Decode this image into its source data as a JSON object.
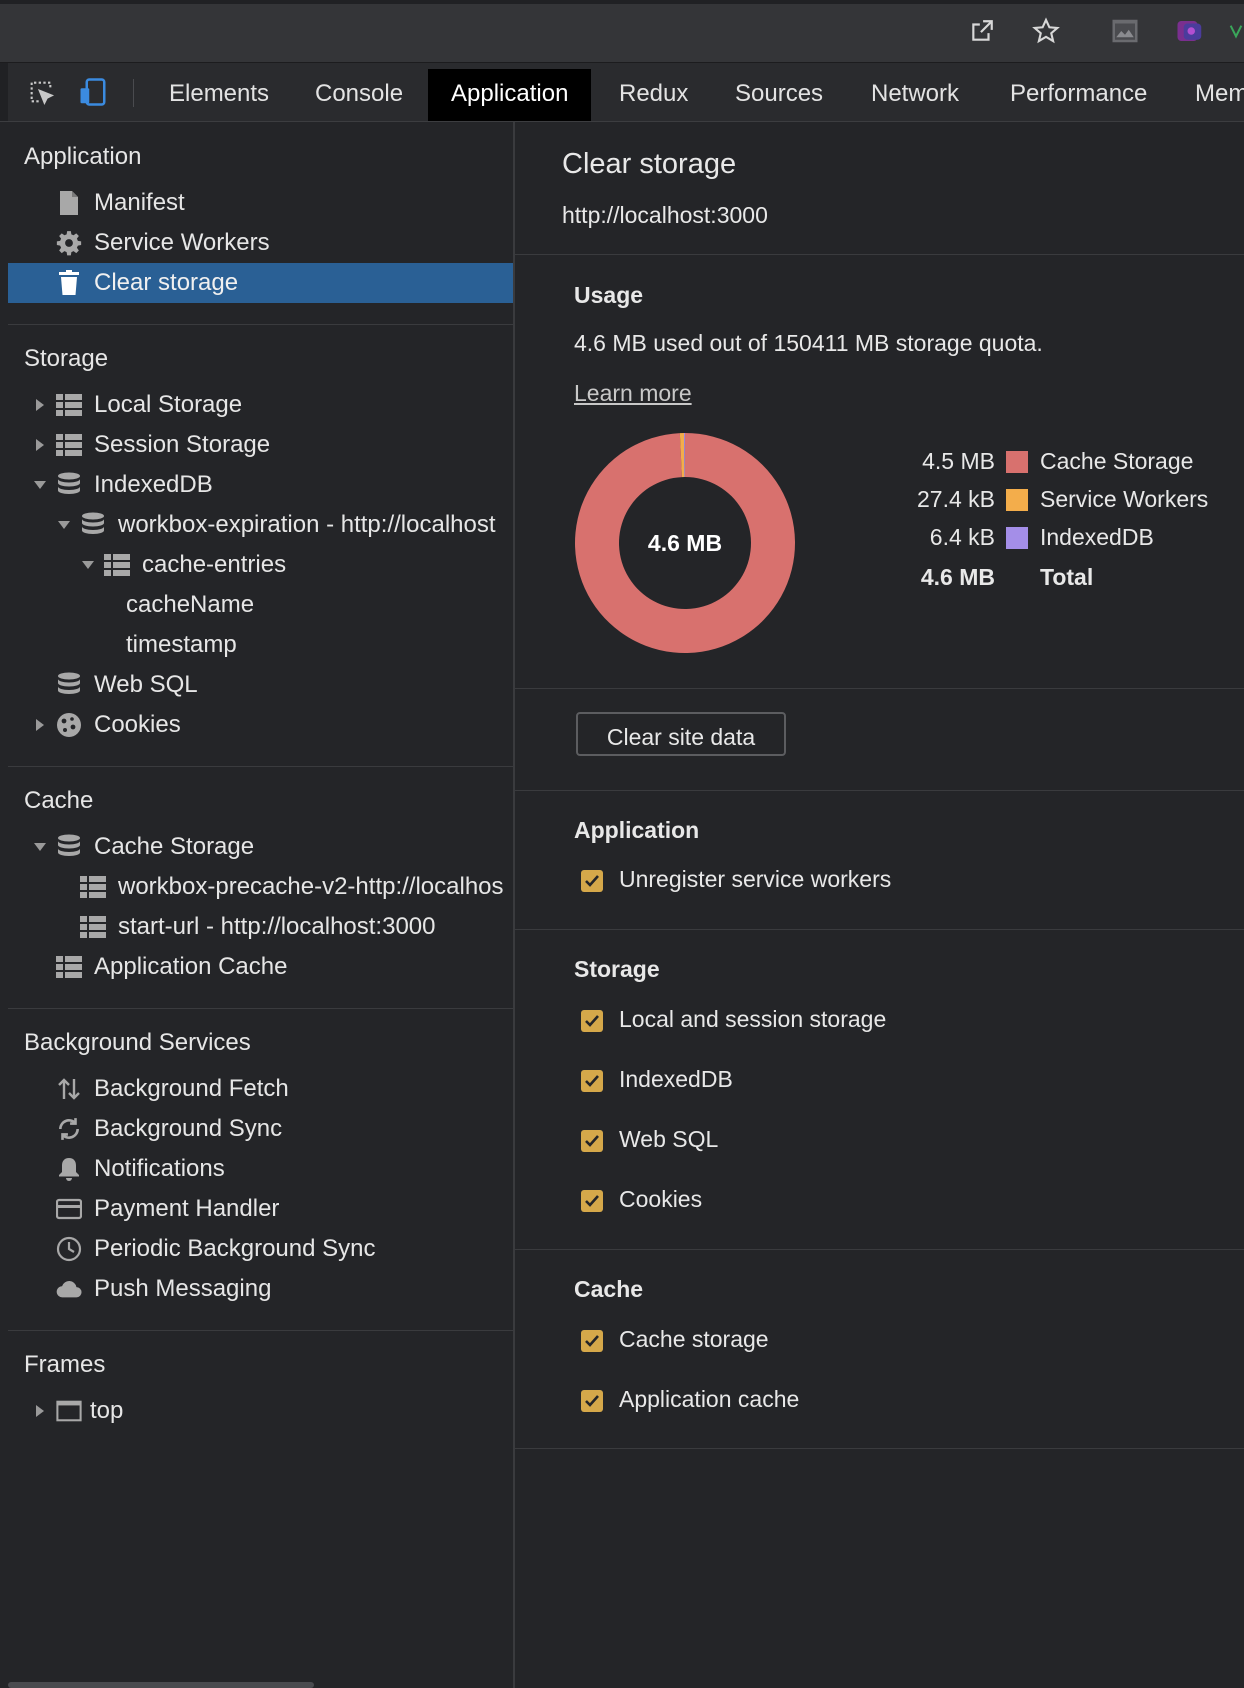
{
  "devtools": {
    "tabs": [
      {
        "label": "Elements"
      },
      {
        "label": "Console"
      },
      {
        "label": "Application"
      },
      {
        "label": "Redux"
      },
      {
        "label": "Sources"
      },
      {
        "label": "Network"
      },
      {
        "label": "Performance"
      },
      {
        "label": "Mem"
      }
    ],
    "active_tab": "Application"
  },
  "sidebar": {
    "application": {
      "title": "Application",
      "items": [
        {
          "label": "Manifest",
          "icon": "document-icon"
        },
        {
          "label": "Service Workers",
          "icon": "gear-icon"
        },
        {
          "label": "Clear storage",
          "icon": "trash-icon",
          "selected": true
        }
      ]
    },
    "storage": {
      "title": "Storage",
      "items": [
        {
          "label": "Local Storage",
          "icon": "grid-icon"
        },
        {
          "label": "Session Storage",
          "icon": "grid-icon"
        },
        {
          "label": "IndexedDB",
          "icon": "database-icon"
        },
        {
          "label": "workbox-expiration - http://localhost",
          "icon": "database-icon"
        },
        {
          "label": "cache-entries",
          "icon": "grid-icon"
        },
        {
          "label": "cacheName"
        },
        {
          "label": "timestamp"
        },
        {
          "label": "Web SQL",
          "icon": "database-icon"
        },
        {
          "label": "Cookies",
          "icon": "cookie-icon"
        }
      ]
    },
    "cache": {
      "title": "Cache",
      "items": [
        {
          "label": "Cache Storage",
          "icon": "database-icon"
        },
        {
          "label": "workbox-precache-v2-http://localhos",
          "icon": "grid-icon"
        },
        {
          "label": "start-url - http://localhost:3000",
          "icon": "grid-icon"
        },
        {
          "label": "Application Cache",
          "icon": "grid-icon"
        }
      ]
    },
    "background_services": {
      "title": "Background Services",
      "items": [
        {
          "label": "Background Fetch",
          "icon": "arrows-updown-icon"
        },
        {
          "label": "Background Sync",
          "icon": "sync-icon"
        },
        {
          "label": "Notifications",
          "icon": "bell-icon"
        },
        {
          "label": "Payment Handler",
          "icon": "card-icon"
        },
        {
          "label": "Periodic Background Sync",
          "icon": "clock-icon"
        },
        {
          "label": "Push Messaging",
          "icon": "cloud-icon"
        }
      ]
    },
    "frames": {
      "title": "Frames",
      "items": [
        {
          "label": "top",
          "icon": "frame-icon"
        }
      ]
    }
  },
  "main": {
    "title": "Clear storage",
    "origin": "http://localhost:3000",
    "usage": {
      "title": "Usage",
      "text": "4.6 MB used out of 150411 MB storage quota.",
      "learn_more": "Learn more",
      "center_label": "4.6 MB"
    },
    "clear_button": "Clear site data",
    "sections": {
      "application": {
        "title": "Application",
        "options": [
          {
            "label": "Unregister service workers",
            "checked": true
          }
        ]
      },
      "storage": {
        "title": "Storage",
        "options": [
          {
            "label": "Local and session storage",
            "checked": true
          },
          {
            "label": "IndexedDB",
            "checked": true
          },
          {
            "label": "Web SQL",
            "checked": true
          },
          {
            "label": "Cookies",
            "checked": true
          }
        ]
      },
      "cache": {
        "title": "Cache",
        "options": [
          {
            "label": "Cache storage",
            "checked": true
          },
          {
            "label": "Application cache",
            "checked": true
          }
        ]
      }
    }
  },
  "chart_data": {
    "type": "pie",
    "categories": [
      "Cache Storage",
      "Service Workers",
      "IndexedDB"
    ],
    "values": [
      4500,
      27.4,
      6.4
    ],
    "labels": [
      "4.5 MB",
      "27.4 kB",
      "6.4 kB"
    ],
    "colors": [
      "#d8716e",
      "#f3ad4b",
      "#a48ee8"
    ],
    "total_label": "Total",
    "total_value": "4.6 MB",
    "legend": "right"
  },
  "colors": {
    "selected_row": "#2a6095",
    "checkbox": "#d5a84a",
    "background": "#242528"
  }
}
